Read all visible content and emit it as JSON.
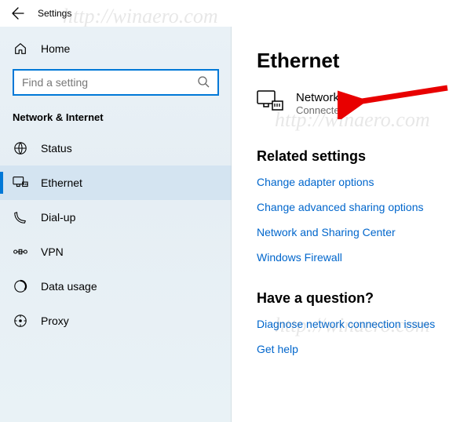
{
  "window": {
    "title": "Settings"
  },
  "sidebar": {
    "home_label": "Home",
    "search_placeholder": "Find a setting",
    "category": "Network & Internet",
    "items": [
      {
        "label": "Status"
      },
      {
        "label": "Ethernet"
      },
      {
        "label": "Dial-up"
      },
      {
        "label": "VPN"
      },
      {
        "label": "Data usage"
      },
      {
        "label": "Proxy"
      }
    ]
  },
  "page": {
    "title": "Ethernet",
    "network_name": "Network",
    "network_status": "Connected",
    "related_header": "Related settings",
    "links": {
      "adapter": "Change adapter options",
      "sharing": "Change advanced sharing options",
      "center": "Network and Sharing Center",
      "firewall": "Windows Firewall"
    },
    "question_header": "Have a question?",
    "question_links": {
      "diagnose": "Diagnose network connection issues",
      "help": "Get help"
    }
  },
  "watermark": "http://winaero.com"
}
